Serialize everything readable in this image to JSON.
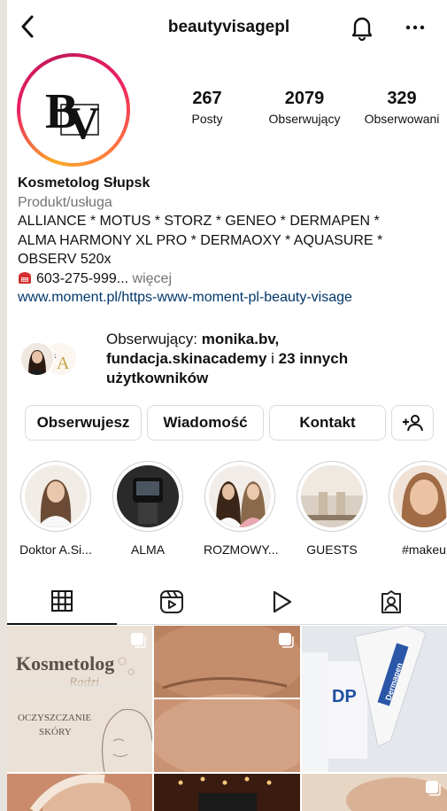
{
  "header": {
    "username": "beautyvisagepl"
  },
  "profile": {
    "avatar_text": "BV"
  },
  "stats": [
    {
      "value": "267",
      "label": "Posty"
    },
    {
      "value": "2079",
      "label": "Obserwujący"
    },
    {
      "value": "329",
      "label": "Obserwowani"
    }
  ],
  "bio": {
    "name": "Kosmetolog Słupsk",
    "category": "Produkt/usługa",
    "line1": "ALLIANCE * MOTUS * STORZ * GENEO * DERMAPEN *",
    "line2": "ALMA HARMONY XL PRO * DERMAOXY * AQUASURE *",
    "line3": "OBSERV 520x",
    "phone": "603-275-999...",
    "more": "więcej",
    "link": "www.moment.pl/https-www-moment-pl-beauty-visage"
  },
  "followed_by": {
    "prefix": "Obserwujący:",
    "user1": "monika.bv,",
    "user2": "fundacja.skinacademy",
    "mid": "i",
    "others": "23 innych",
    "suffix": "użytkowników"
  },
  "buttons": {
    "following": "Obserwujesz",
    "message": "Wiadomość",
    "contact": "Kontakt"
  },
  "highlights": [
    {
      "label": "Doktor A.Si..."
    },
    {
      "label": "ALMA"
    },
    {
      "label": "ROZMOWY..."
    },
    {
      "label": "GUESTS"
    },
    {
      "label": "#makeu"
    }
  ],
  "tabs": [
    {
      "icon": "grid-icon"
    },
    {
      "icon": "reels-icon"
    },
    {
      "icon": "play-icon"
    },
    {
      "icon": "tagged-icon"
    }
  ],
  "posts": {
    "post1_title": "Kosmetolog",
    "post1_script": "Radzi",
    "post1_sub1": "OCZYSZCZANIE",
    "post1_sub2": "SKÓRY",
    "post3_brand": "Dermapen"
  },
  "colors": {
    "link": "#00376b",
    "secondary": "#737373",
    "border": "#dbdbdb"
  }
}
